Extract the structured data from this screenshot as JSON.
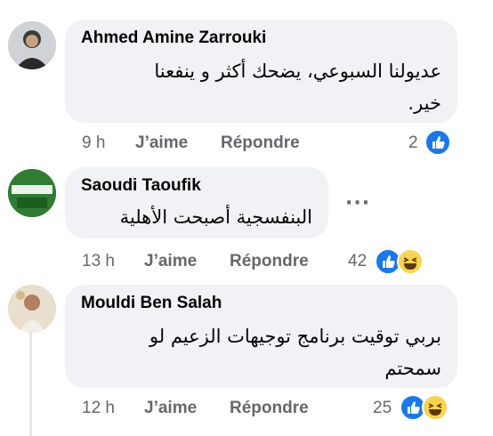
{
  "comments": [
    {
      "author": "Ahmed Amine Zarrouki",
      "text_line1": "عديولنا السبوعي، يضحك أكثر و ينفعنا",
      "text_line2": "خير.",
      "time": "9 h",
      "like_label": "J’aime",
      "reply_label": "Répondre",
      "reaction_count": "2",
      "reactions": [
        "like-icon"
      ]
    },
    {
      "author": "Saoudi Taoufik",
      "avatar_text": "أسوان الطاحون",
      "text_line1": "البنفسجية أصبحت الأهلية",
      "more": "···",
      "time": "13 h",
      "like_label": "J’aime",
      "reply_label": "Répondre",
      "reaction_count": "42",
      "reactions": [
        "like-icon",
        "haha-icon"
      ]
    },
    {
      "author": "Mouldi Ben Salah",
      "text_line1": "بربي توقيت برنامج توجيهات الزعيم لو",
      "text_line2": "سمحتم",
      "time": "12 h",
      "like_label": "J’aime",
      "reply_label": "Répondre",
      "reaction_count": "25",
      "reactions": [
        "like-icon",
        "haha-icon"
      ]
    }
  ],
  "colors": {
    "bubble": "#f0f2f5",
    "meta": "#65676b",
    "like": "#1877f2",
    "haha": "#fcd34d"
  }
}
